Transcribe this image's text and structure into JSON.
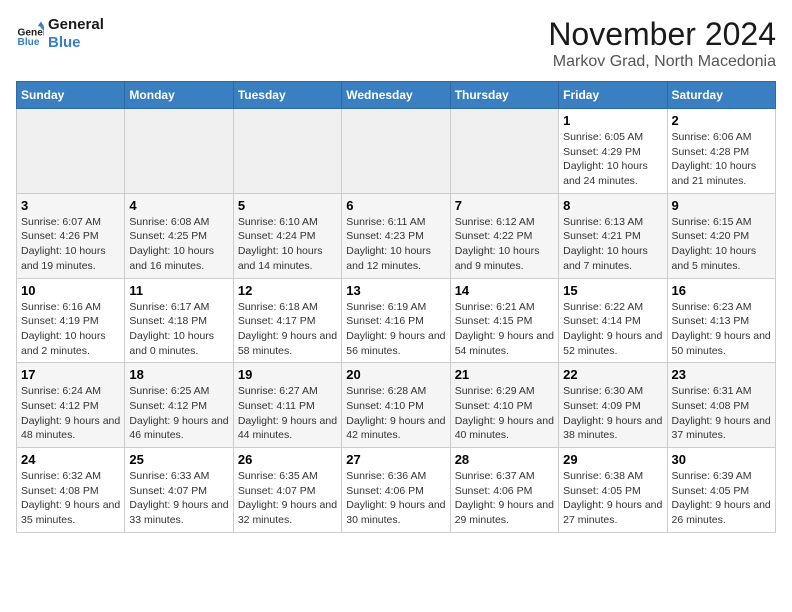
{
  "logo": {
    "line1": "General",
    "line2": "Blue"
  },
  "title": "November 2024",
  "location": "Markov Grad, North Macedonia",
  "days_of_week": [
    "Sunday",
    "Monday",
    "Tuesday",
    "Wednesday",
    "Thursday",
    "Friday",
    "Saturday"
  ],
  "weeks": [
    [
      {
        "day": "",
        "info": ""
      },
      {
        "day": "",
        "info": ""
      },
      {
        "day": "",
        "info": ""
      },
      {
        "day": "",
        "info": ""
      },
      {
        "day": "",
        "info": ""
      },
      {
        "day": "1",
        "info": "Sunrise: 6:05 AM\nSunset: 4:29 PM\nDaylight: 10 hours and 24 minutes."
      },
      {
        "day": "2",
        "info": "Sunrise: 6:06 AM\nSunset: 4:28 PM\nDaylight: 10 hours and 21 minutes."
      }
    ],
    [
      {
        "day": "3",
        "info": "Sunrise: 6:07 AM\nSunset: 4:26 PM\nDaylight: 10 hours and 19 minutes."
      },
      {
        "day": "4",
        "info": "Sunrise: 6:08 AM\nSunset: 4:25 PM\nDaylight: 10 hours and 16 minutes."
      },
      {
        "day": "5",
        "info": "Sunrise: 6:10 AM\nSunset: 4:24 PM\nDaylight: 10 hours and 14 minutes."
      },
      {
        "day": "6",
        "info": "Sunrise: 6:11 AM\nSunset: 4:23 PM\nDaylight: 10 hours and 12 minutes."
      },
      {
        "day": "7",
        "info": "Sunrise: 6:12 AM\nSunset: 4:22 PM\nDaylight: 10 hours and 9 minutes."
      },
      {
        "day": "8",
        "info": "Sunrise: 6:13 AM\nSunset: 4:21 PM\nDaylight: 10 hours and 7 minutes."
      },
      {
        "day": "9",
        "info": "Sunrise: 6:15 AM\nSunset: 4:20 PM\nDaylight: 10 hours and 5 minutes."
      }
    ],
    [
      {
        "day": "10",
        "info": "Sunrise: 6:16 AM\nSunset: 4:19 PM\nDaylight: 10 hours and 2 minutes."
      },
      {
        "day": "11",
        "info": "Sunrise: 6:17 AM\nSunset: 4:18 PM\nDaylight: 10 hours and 0 minutes."
      },
      {
        "day": "12",
        "info": "Sunrise: 6:18 AM\nSunset: 4:17 PM\nDaylight: 9 hours and 58 minutes."
      },
      {
        "day": "13",
        "info": "Sunrise: 6:19 AM\nSunset: 4:16 PM\nDaylight: 9 hours and 56 minutes."
      },
      {
        "day": "14",
        "info": "Sunrise: 6:21 AM\nSunset: 4:15 PM\nDaylight: 9 hours and 54 minutes."
      },
      {
        "day": "15",
        "info": "Sunrise: 6:22 AM\nSunset: 4:14 PM\nDaylight: 9 hours and 52 minutes."
      },
      {
        "day": "16",
        "info": "Sunrise: 6:23 AM\nSunset: 4:13 PM\nDaylight: 9 hours and 50 minutes."
      }
    ],
    [
      {
        "day": "17",
        "info": "Sunrise: 6:24 AM\nSunset: 4:12 PM\nDaylight: 9 hours and 48 minutes."
      },
      {
        "day": "18",
        "info": "Sunrise: 6:25 AM\nSunset: 4:12 PM\nDaylight: 9 hours and 46 minutes."
      },
      {
        "day": "19",
        "info": "Sunrise: 6:27 AM\nSunset: 4:11 PM\nDaylight: 9 hours and 44 minutes."
      },
      {
        "day": "20",
        "info": "Sunrise: 6:28 AM\nSunset: 4:10 PM\nDaylight: 9 hours and 42 minutes."
      },
      {
        "day": "21",
        "info": "Sunrise: 6:29 AM\nSunset: 4:10 PM\nDaylight: 9 hours and 40 minutes."
      },
      {
        "day": "22",
        "info": "Sunrise: 6:30 AM\nSunset: 4:09 PM\nDaylight: 9 hours and 38 minutes."
      },
      {
        "day": "23",
        "info": "Sunrise: 6:31 AM\nSunset: 4:08 PM\nDaylight: 9 hours and 37 minutes."
      }
    ],
    [
      {
        "day": "24",
        "info": "Sunrise: 6:32 AM\nSunset: 4:08 PM\nDaylight: 9 hours and 35 minutes."
      },
      {
        "day": "25",
        "info": "Sunrise: 6:33 AM\nSunset: 4:07 PM\nDaylight: 9 hours and 33 minutes."
      },
      {
        "day": "26",
        "info": "Sunrise: 6:35 AM\nSunset: 4:07 PM\nDaylight: 9 hours and 32 minutes."
      },
      {
        "day": "27",
        "info": "Sunrise: 6:36 AM\nSunset: 4:06 PM\nDaylight: 9 hours and 30 minutes."
      },
      {
        "day": "28",
        "info": "Sunrise: 6:37 AM\nSunset: 4:06 PM\nDaylight: 9 hours and 29 minutes."
      },
      {
        "day": "29",
        "info": "Sunrise: 6:38 AM\nSunset: 4:05 PM\nDaylight: 9 hours and 27 minutes."
      },
      {
        "day": "30",
        "info": "Sunrise: 6:39 AM\nSunset: 4:05 PM\nDaylight: 9 hours and 26 minutes."
      }
    ]
  ]
}
